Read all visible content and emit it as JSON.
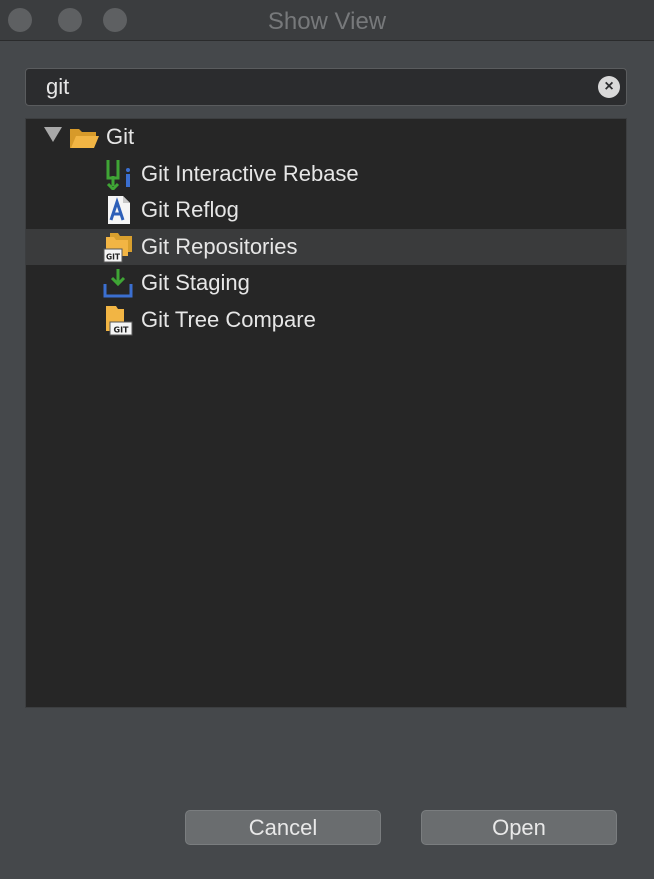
{
  "window": {
    "title": "Show View",
    "traffic_lights": [
      "close",
      "minimize",
      "zoom"
    ]
  },
  "search": {
    "value": "git",
    "clear_icon": "clear-circle-icon"
  },
  "tree": {
    "group": {
      "label": "Git",
      "expanded": true,
      "icon": "folder-open-icon"
    },
    "items": [
      {
        "label": "Git Interactive Rebase",
        "icon": "interactive-rebase-icon",
        "selected": false
      },
      {
        "label": "Git Reflog",
        "icon": "reflog-icon",
        "selected": false
      },
      {
        "label": "Git Repositories",
        "icon": "repositories-icon",
        "selected": true
      },
      {
        "label": "Git Staging",
        "icon": "staging-icon",
        "selected": false
      },
      {
        "label": "Git Tree Compare",
        "icon": "tree-compare-icon",
        "selected": false
      }
    ]
  },
  "buttons": {
    "cancel": "Cancel",
    "open": "Open"
  },
  "colors": {
    "background": "#45484b",
    "tree_background": "#262626",
    "selection": "#3a3b3c",
    "text": "#e6e6e6"
  }
}
